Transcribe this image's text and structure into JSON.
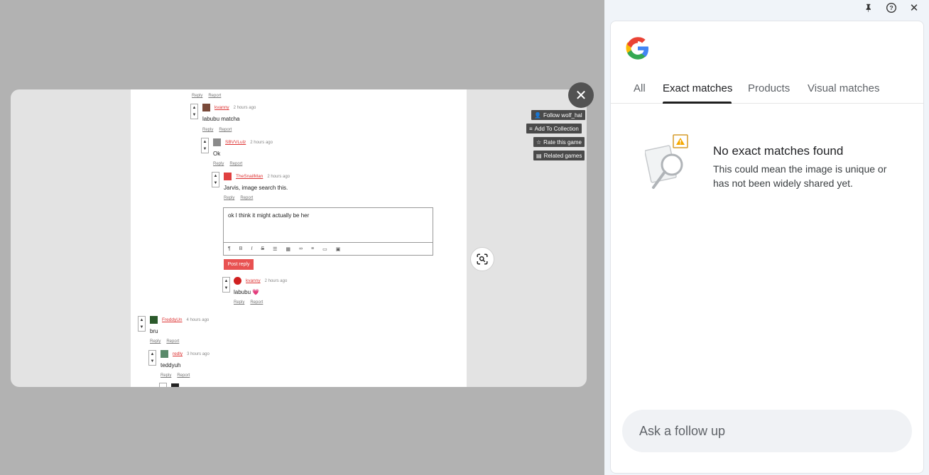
{
  "panel": {
    "tabs": [
      "All",
      "Exact matches",
      "Products",
      "Visual matches"
    ],
    "active_tab": "Exact matches",
    "empty_title": "No exact matches found",
    "empty_desc": "This could mean the image is unique or has not been widely shared yet.",
    "followup_placeholder": "Ask a follow up"
  },
  "top_icons": [
    "pin-icon",
    "help-icon",
    "close-icon"
  ],
  "preview": {
    "side_buttons": [
      "Follow wolf_hal",
      "Add To Collection",
      "Rate this game",
      "Related games"
    ],
    "comments": [
      {
        "user": "kvanny",
        "time": "2 hours ago",
        "text": "labubu matcha"
      },
      {
        "user": "SBVVLulz",
        "time": "2 hours ago",
        "text": "Ok"
      },
      {
        "user": "TheSnailMan",
        "time": "2 hours ago",
        "text": "Jarvis, image search this."
      },
      {
        "user": "kvanny",
        "time": "2 hours ago",
        "text": "labubu 💗"
      },
      {
        "user": "FreddyUn",
        "time": "4 hours ago",
        "text": "bru"
      },
      {
        "user": "redly",
        "time": "3 hours ago",
        "text": "teddyuh"
      }
    ],
    "reply_label": "Reply",
    "report_label": "Report",
    "editor_text": "ok I think it might actually be her",
    "post_reply_label": "Post reply"
  },
  "colors": {
    "accent": "#e85151",
    "panel_bg": "#f0f4f9",
    "user_link": "#d33333"
  }
}
